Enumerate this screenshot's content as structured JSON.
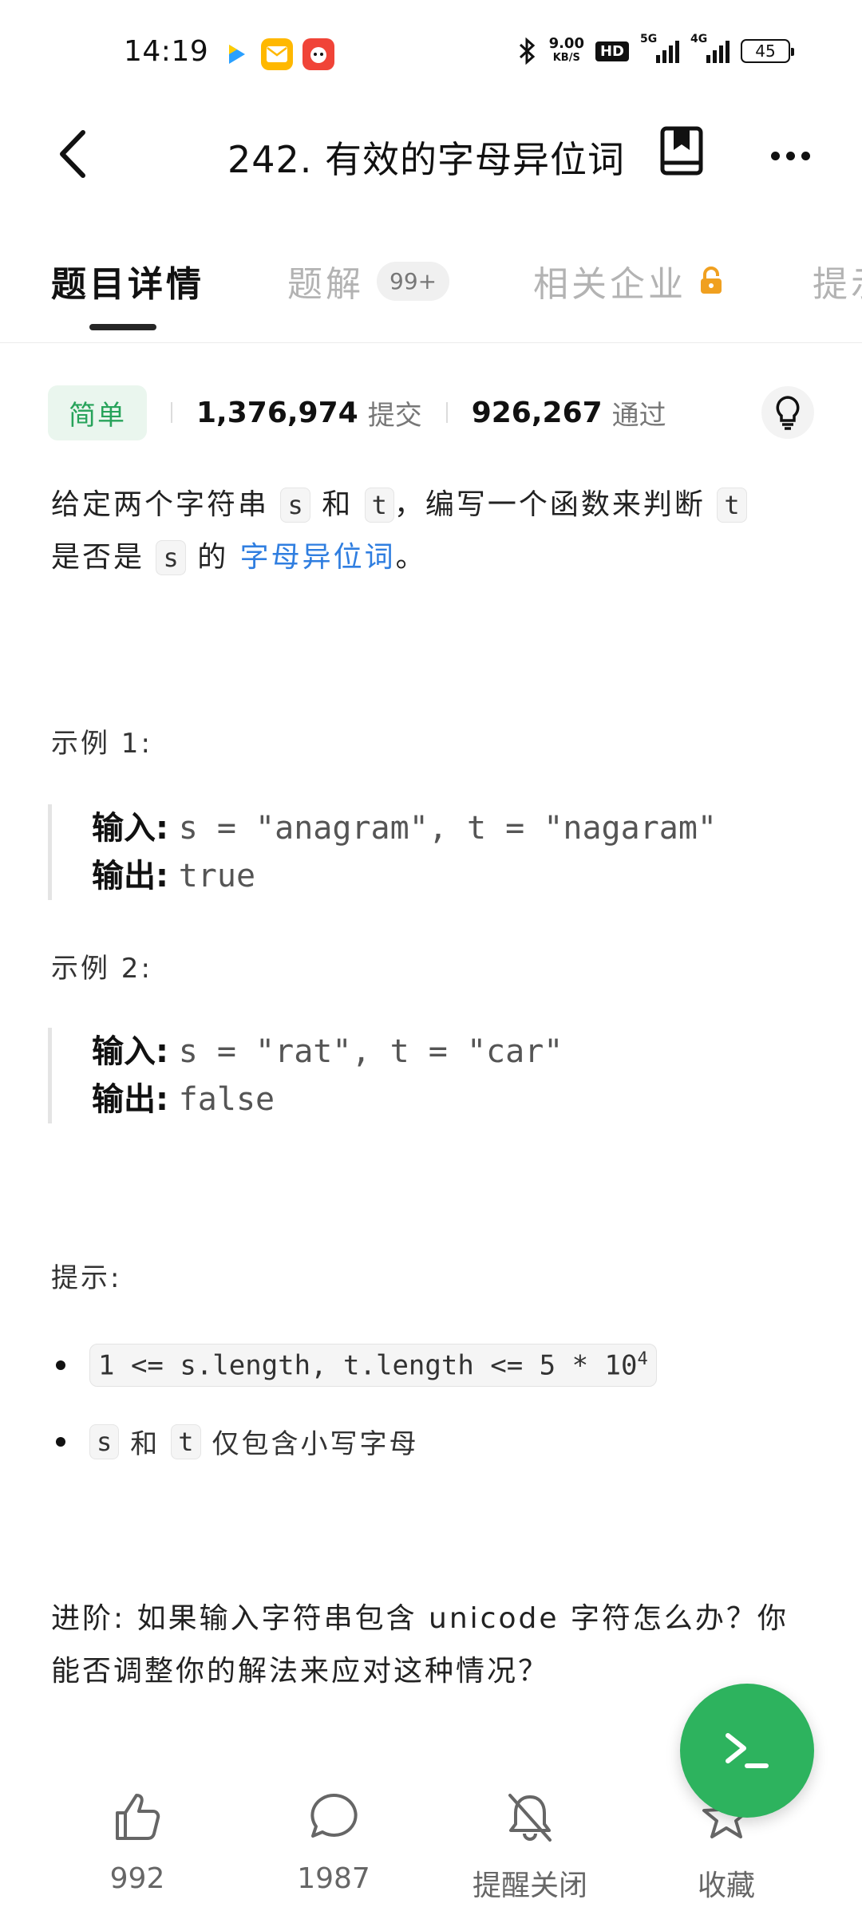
{
  "status_bar": {
    "time": "14:19",
    "net_speed_value": "9.00",
    "net_speed_unit": "KB/S",
    "hd": "HD",
    "sig1": "5G",
    "sig2": "4G",
    "battery": "45"
  },
  "header": {
    "title": "242. 有效的字母异位词"
  },
  "tabs": [
    {
      "label": "题目详情",
      "active": true
    },
    {
      "label": "题解",
      "badge": "99+"
    },
    {
      "label": "相关企业"
    },
    {
      "label": "提示"
    }
  ],
  "stats": {
    "difficulty": "简单",
    "submissions_count": "1,376,974",
    "submissions_label": "提交",
    "accepted_count": "926,267",
    "accepted_label": "通过"
  },
  "description": {
    "p1": "给定两个字符串",
    "code_s": "s",
    "p2": "和",
    "code_t": "t",
    "p3": "，编写一个函数来判断",
    "p4": "是否是",
    "p5": "的",
    "link": "字母异位词",
    "p6": "。"
  },
  "examples": [
    {
      "title": "示例 1:",
      "input_label": "输入:",
      "input": "s = \"anagram\", t = \"nagaram\"",
      "output_label": "输出:",
      "output": "true"
    },
    {
      "title": "示例 2:",
      "input_label": "输入:",
      "input": "s = \"rat\", t = \"car\"",
      "output_label": "输出:",
      "output": "false"
    }
  ],
  "hints": {
    "title": "提示:",
    "constraint": "1 <= s.length, t.length <= 5 * 10",
    "constraint_exp": "4",
    "item2_s": "s",
    "item2_and": "和",
    "item2_t": "t",
    "item2_text": "仅包含小写字母"
  },
  "advanced": "进阶: 如果输入字符串包含 unicode 字符怎么办？你能否调整你的解法来应对这种情况？",
  "bottom_bar": {
    "like_count": "992",
    "comment_count": "1987",
    "notify_label": "提醒关闭",
    "favorite_label": "收藏"
  },
  "colors": {
    "accent_green": "#2db35e",
    "difficulty_green": "#27a35a",
    "link_blue": "#2f7ee0",
    "lock_orange": "#f0a020"
  }
}
